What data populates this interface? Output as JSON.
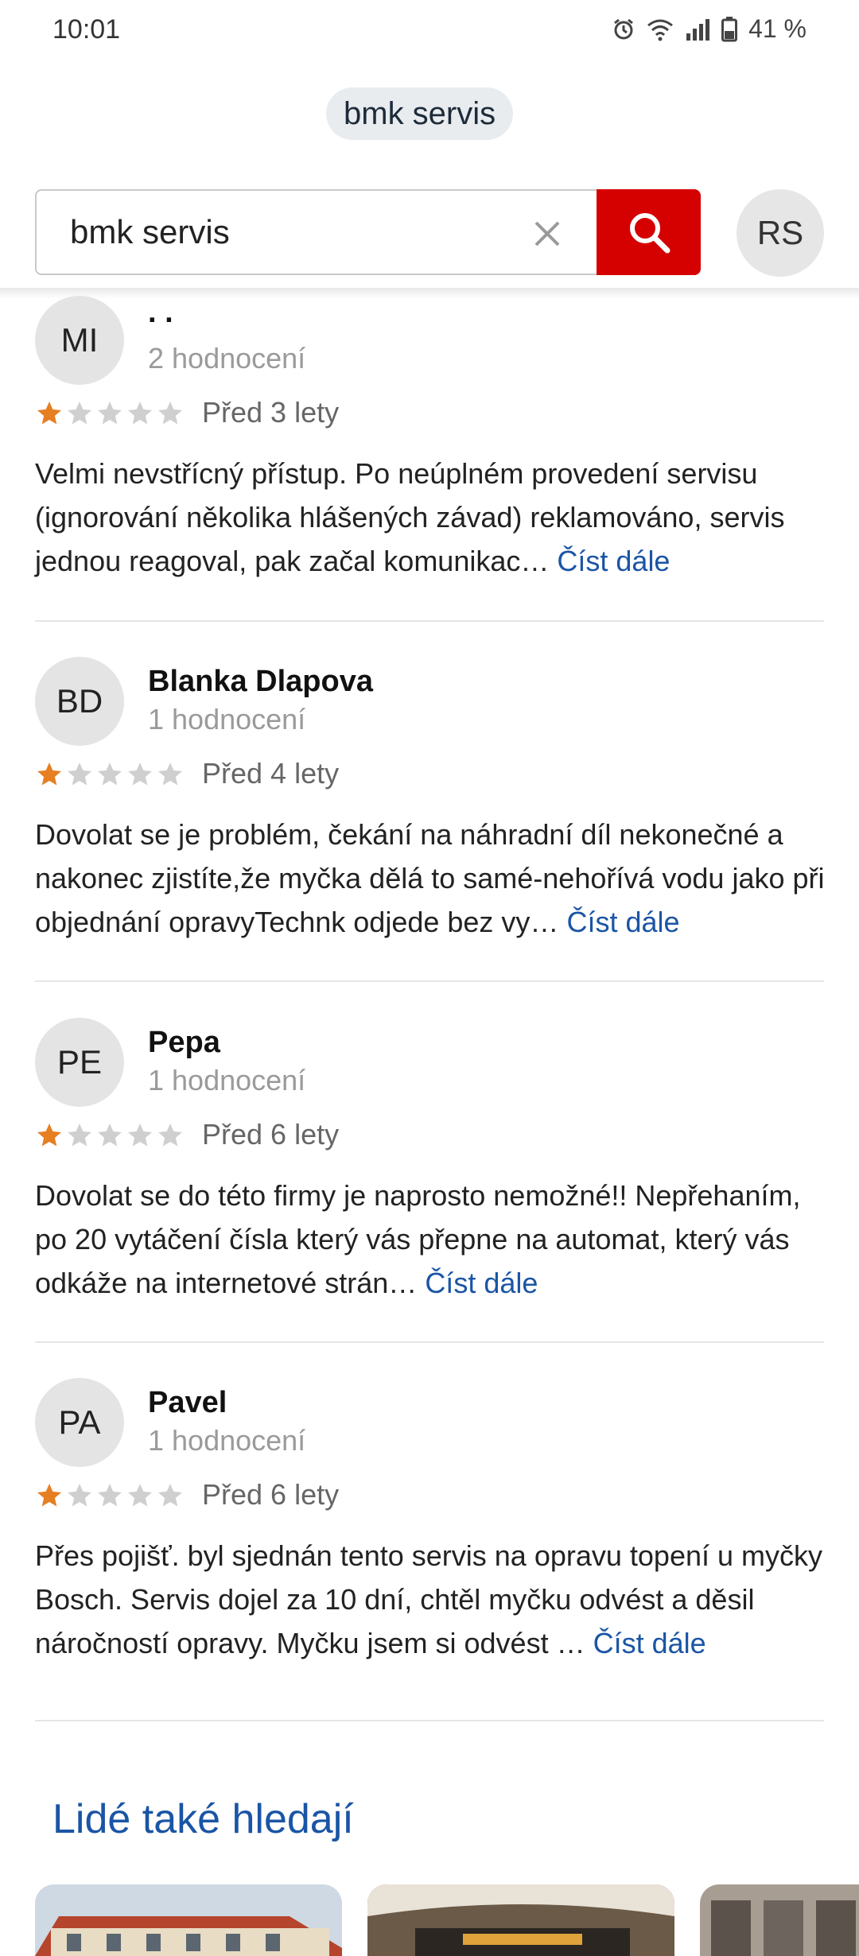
{
  "status_bar": {
    "time": "10:01",
    "battery": "41 %"
  },
  "query_chip": "bmk servis",
  "search": {
    "value": "bmk servis"
  },
  "user_avatar": "RS",
  "reviews": [
    {
      "initials": "MI",
      "name": ". .",
      "count": "2 hodnocení",
      "rating": 1,
      "time": "Před 3 lety",
      "text": "Velmi nevstřícný přístup. Po neúplném provedení servisu (ignorování několika hlášených závad) reklamováno, servis jednou reagoval, pak začal komunikac…",
      "more": "Číst dále"
    },
    {
      "initials": "BD",
      "name": "Blanka Dlapova",
      "count": "1 hodnocení",
      "rating": 1,
      "time": "Před 4 lety",
      "text": "Dovolat se je problém, čekání na náhradní díl nekonečné a nakonec zjistíte,že myčka dělá to samé-nehořívá vodu jako při objednání opravyTechnk odjede bez vy…",
      "more": "Číst dále"
    },
    {
      "initials": "PE",
      "name": "Pepa",
      "count": "1 hodnocení",
      "rating": 1,
      "time": "Před 6 lety",
      "text": "Dovolat se do této firmy je naprosto nemožné!! Nepřehaním, po 20 vytáčení čísla který vás přepne na automat, který vás odkáže na internetové strán…",
      "more": "Číst dále"
    },
    {
      "initials": "PA",
      "name": "Pavel",
      "count": "1 hodnocení",
      "rating": 1,
      "time": "Před 6 lety",
      "text": "Přes pojišť. byl sjednán tento servis na opravu topení u myčky Bosch. Servis dojel za 10 dní, chtěl myčku odvést a děsil náročností opravy. Myčku jsem si odvést …",
      "more": "Číst dále"
    }
  ],
  "people_also_search": {
    "title": "Lidé také hledají"
  },
  "colors": {
    "accent": "#d50000",
    "link": "#1a55a5",
    "star_filled": "#e67e22",
    "star_empty": "#cfcfcf"
  }
}
